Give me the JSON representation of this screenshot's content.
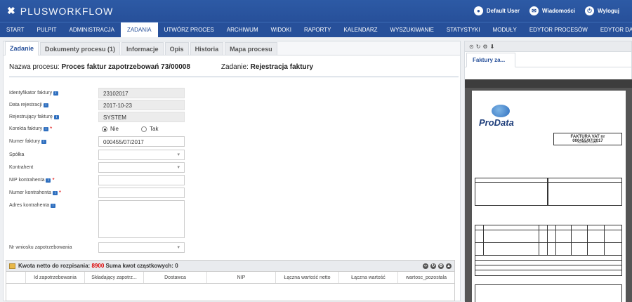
{
  "app": {
    "logo_text": "PLUSWORKFLOW",
    "user_label": "Default User",
    "messages_label": "Wiadomości",
    "logout_label": "Wyloguj"
  },
  "menu": [
    "START",
    "PULPIT",
    "ADMINISTRACJA",
    "ZADANIA",
    "UTWÓRZ PROCES",
    "ARCHIWUM",
    "WIDOKI",
    "RAPORTY",
    "KALENDARZ",
    "WYSZUKIWANIE",
    "STATYSTYKI",
    "MODUŁY",
    "EDYTOR PROCESÓW",
    "EDYTOR DANYCH"
  ],
  "active_menu": "ZADANIA",
  "tabs": [
    "Zadanie",
    "Dokumenty procesu (1)",
    "Informacje",
    "Opis",
    "Historia",
    "Mapa procesu"
  ],
  "process": {
    "name_label": "Nazwa procesu:",
    "name_value": "Proces faktur zapotrzebowań 73/00008",
    "task_label": "Zadanie:",
    "task_value": "Rejestracja faktury"
  },
  "form": {
    "invoice_id": {
      "label": "Identyfikator faktury",
      "value": "23102017"
    },
    "reg_date": {
      "label": "Data rejestracji",
      "value": "2017-10-23"
    },
    "registrar": {
      "label": "Rejestrujący fakturę",
      "value": "SYSTEM"
    },
    "correction": {
      "label": "Korekta faktury",
      "opt_no": "Nie",
      "opt_yes": "Tak"
    },
    "invoice_no": {
      "label": "Numer faktury",
      "value": "000455/07/2017"
    },
    "company": {
      "label": "Spółka",
      "value": ""
    },
    "contractor": {
      "label": "Kontrahent",
      "value": ""
    },
    "nip": {
      "label": "NIP kontrahenta",
      "value": ""
    },
    "contractor_no": {
      "label": "Numer kontrahenta",
      "value": ""
    },
    "contractor_addr": {
      "label": "Adres kontrahenta",
      "value": ""
    },
    "request_no": {
      "label": "Nr wniosku zapotrzebowania",
      "value": ""
    }
  },
  "grid": {
    "header_prefix": "Kwota netto do rozpisania:",
    "amount": "8900",
    "header_suffix": "Suma kwot cząstkowych: 0",
    "columns": [
      "Id zapotrzebowania",
      "Składający zapotrz...",
      "Dostawca",
      "NIP",
      "Łączna wartość netto",
      "Łączna wartość",
      "wartosc_pozostala"
    ]
  },
  "preview": {
    "tab_label": "Faktury za...",
    "invoice_title": "FAKTURA VAT nr 000455/07/2017",
    "invoice_sub": "ORYGINAŁ / KOPIA *",
    "logo": "ProData"
  },
  "colors": {
    "brand": "#27509a",
    "required": "#dd0000"
  }
}
